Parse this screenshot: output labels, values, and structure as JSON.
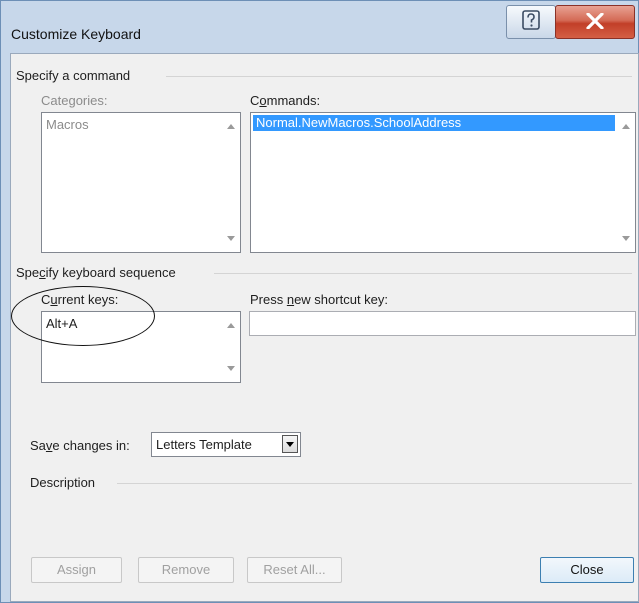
{
  "window": {
    "title": "Customize Keyboard"
  },
  "titlebar": {
    "help_icon": "help-icon",
    "close_icon": "close-icon"
  },
  "command": {
    "section_label": "Specify a command",
    "categories_label": "Categories:",
    "categories": [
      "Macros"
    ],
    "commands_label": "Commands:",
    "commands": [
      "Normal.NewMacros.SchoolAddress"
    ],
    "selected_command": "Normal.NewMacros.SchoolAddress"
  },
  "keyboard": {
    "section_label": "Specify keyboard sequence",
    "current_keys_label": "Current keys:",
    "current_keys": [
      "Alt+A"
    ],
    "new_shortcut_label": "Press new shortcut key:",
    "new_shortcut_value": ""
  },
  "save": {
    "label": "Save changes in:",
    "value": "Letters Template"
  },
  "description": {
    "section_label": "Description",
    "text": ""
  },
  "buttons": {
    "assign": "Assign",
    "remove": "Remove",
    "reset_all": "Reset All...",
    "close": "Close"
  },
  "colors": {
    "selection": "#3399ff",
    "frame": "#c7d7ea",
    "dialog_bg": "#f0f0f0",
    "close_button": "#c9462f"
  }
}
